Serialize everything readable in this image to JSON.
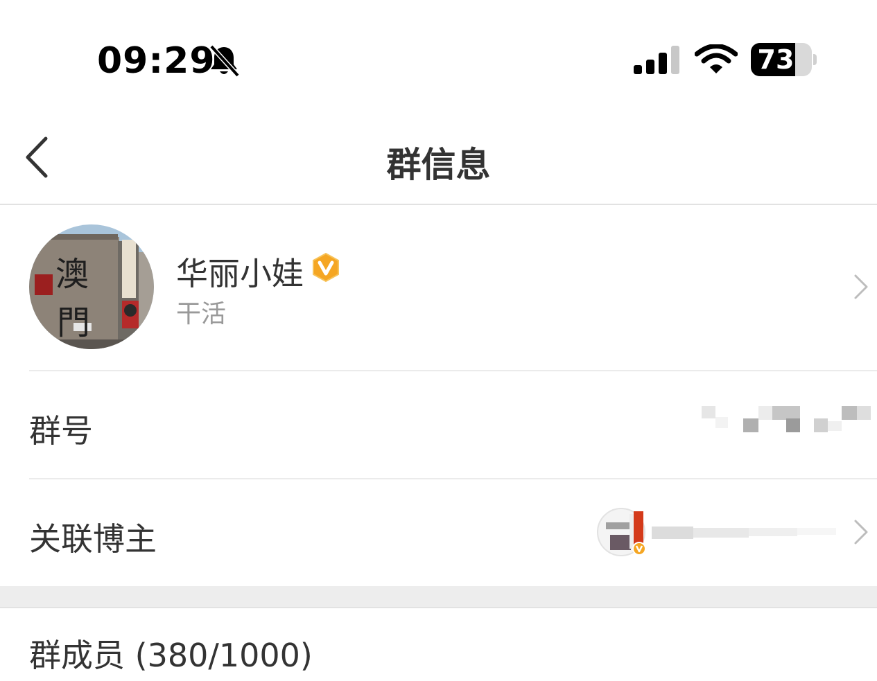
{
  "status_bar": {
    "time": "09:29",
    "battery": "73",
    "battery_level": 0.73,
    "icons": [
      "bell-slash-icon",
      "cellular-signal-icon",
      "wifi-icon",
      "battery-icon"
    ]
  },
  "nav": {
    "title": "群信息",
    "back_icon": "chevron-left-icon"
  },
  "group": {
    "name": "华丽小娃",
    "badge_icon": "verified-v-badge-icon",
    "badge_color": "#f5a623",
    "subtitle": "干活",
    "avatar_sign_text": "澳門"
  },
  "rows": {
    "group_id_label": "群号",
    "linked_blogger_label": "关联博主",
    "members_label": "群成员 (380/1000)"
  },
  "colors": {
    "text": "#333333",
    "subtext": "#999999",
    "divider": "#ebebeb",
    "section_band": "#ededed"
  }
}
